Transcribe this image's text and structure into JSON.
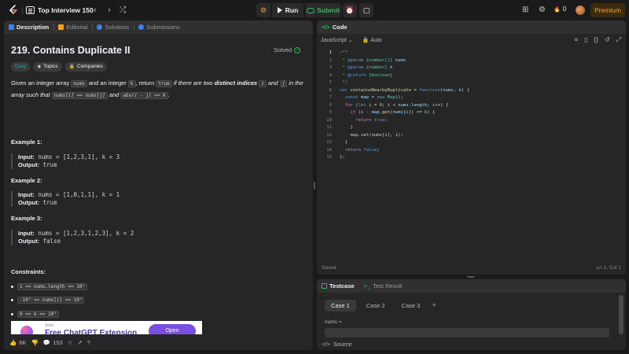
{
  "topbar": {
    "problem_list": "Top Interview 150",
    "prev_icon": "‹",
    "next_icon": "›",
    "shuffle_icon": "⤮",
    "debug_icon": "⚙",
    "run_label": "Run",
    "submit_label": "Submit",
    "timer_icon": "⏰",
    "notes_icon": "▢",
    "layout_icon": "⊞",
    "settings_icon": "⚙",
    "fire_icon": "🔥",
    "streak_count": "0",
    "premium_label": "Premium"
  },
  "left_tabs": [
    {
      "label": "Description"
    },
    {
      "label": "Editorial"
    },
    {
      "label": "Solutions"
    },
    {
      "label": "Submissions"
    }
  ],
  "problem": {
    "title": "219. Contains Duplicate II",
    "status": "Solved",
    "difficulty": "Easy",
    "topics_label": "Topics",
    "companies_label": "Companies",
    "desc_1": "Given an integer array ",
    "code_nums": "nums",
    "desc_2": " and an integer ",
    "code_k": "k",
    "desc_3": ", return ",
    "code_true": "true",
    "desc_4": " if there are two ",
    "desc_bold": "distinct indices",
    "desc_5": " ",
    "code_i": "i",
    "desc_6": " and ",
    "code_j": "j",
    "desc_7": " in the array such that ",
    "code_eq": "nums[i] == nums[j]",
    "desc_8": " and ",
    "code_abs": "abs(i - j) <= k",
    "desc_9": ".",
    "examples": [
      {
        "title": "Example 1:",
        "input_label": "Input:",
        "input": "nums = [1,2,3,1], k = 3",
        "output_label": "Output:",
        "output": "true"
      },
      {
        "title": "Example 2:",
        "input_label": "Input:",
        "input": "nums = [1,0,1,1], k = 1",
        "output_label": "Output:",
        "output": "true"
      },
      {
        "title": "Example 3:",
        "input_label": "Input:",
        "input": "nums = [1,2,3,1,2,3], k = 2",
        "output_label": "Output:",
        "output": "false"
      }
    ],
    "constraints_title": "Constraints:",
    "constraints": [
      "1 <= nums.length <= 10⁵",
      "-10⁹ <= nums[i] <= 10⁹",
      "0 <= k <= 10⁵"
    ]
  },
  "ad": {
    "brand": "Sider",
    "text": "Free ChatGPT Extension",
    "button": "Open"
  },
  "bottom_bar": {
    "likes": "6K",
    "comments": "153"
  },
  "code_panel": {
    "tab_label": "Code",
    "language": "JavaScript",
    "mode": "Auto",
    "saved": "Saved",
    "cursor": "Ln 1, Col 1",
    "lines": [
      {
        "n": "1",
        "html": "<span class='c-com'>/**</span>"
      },
      {
        "n": "2",
        "html": "<span class='c-com'> * </span><span class='c-tag'>@param</span><span class='c-com'> </span><span class='c-type'>{number[]}</span><span class='c-com'> </span><span class='c-param'>nums</span>"
      },
      {
        "n": "3",
        "html": "<span class='c-com'> * </span><span class='c-tag'>@param</span><span class='c-com'> </span><span class='c-type'>{number}</span><span class='c-com'> </span><span class='c-param'>k</span>"
      },
      {
        "n": "4",
        "html": "<span class='c-com'> * </span><span class='c-tag'>@return</span><span class='c-com'> </span><span class='c-type'>{boolean}</span>"
      },
      {
        "n": "5",
        "html": "<span class='c-com'> */</span>"
      },
      {
        "n": "6",
        "html": "<span class='c-kw'>var</span> <span class='c-fn'>containsNearbyDuplicate</span> = <span class='c-kw'>function</span>(<span class='c-var'>nums</span>, <span class='c-var'>k</span>) {"
      },
      {
        "n": "7",
        "html": "  <span class='c-kw'>const</span> <span class='c-var'>map</span> = <span class='c-kw'>new</span> <span class='c-type'>Map</span>();"
      },
      {
        "n": "8",
        "html": "  <span class='c-ctl'>for</span> (<span class='c-kw'>let</span> <span class='c-var'>i</span> = <span class='c-num'>0</span>; <span class='c-var'>i</span> &lt; <span class='c-var'>nums</span>.<span class='c-var'>length</span>; <span class='c-var'>i</span>++) {"
      },
      {
        "n": "9",
        "html": "    <span class='c-ctl'>if</span> (<span class='c-var'>i</span> - <span class='c-var'>map</span>.<span class='c-fn'>get</span>(<span class='c-var'>nums</span>[<span class='c-var'>i</span>]) &lt;= <span class='c-var'>k</span>) {"
      },
      {
        "n": "10",
        "html": "      <span class='c-ctl'>return</span> <span class='c-kw'>true</span>;"
      },
      {
        "n": "11",
        "html": "    }"
      },
      {
        "n": "12",
        "html": "    <span class='c-var'>map</span>.<span class='c-fn'>set</span>(<span class='c-var'>nums</span>[<span class='c-var'>i</span>], <span class='c-var'>i</span>);"
      },
      {
        "n": "13",
        "html": "  }"
      },
      {
        "n": "14",
        "html": "  <span class='c-ctl'>return</span> <span class='c-kw'>false</span>;"
      },
      {
        "n": "15",
        "html": "};"
      }
    ]
  },
  "test_panel": {
    "testcase_label": "Testcase",
    "result_label": "Test Result",
    "cases": [
      "Case 1",
      "Case 2",
      "Case 3"
    ],
    "add_icon": "+",
    "field_label": "nums =",
    "source_label": "Source"
  },
  "colors": {
    "accent": "#ffa116",
    "success": "#2cbb5d",
    "easy": "#00b8a3",
    "panel": "#262626",
    "background": "#1a1a1a"
  }
}
